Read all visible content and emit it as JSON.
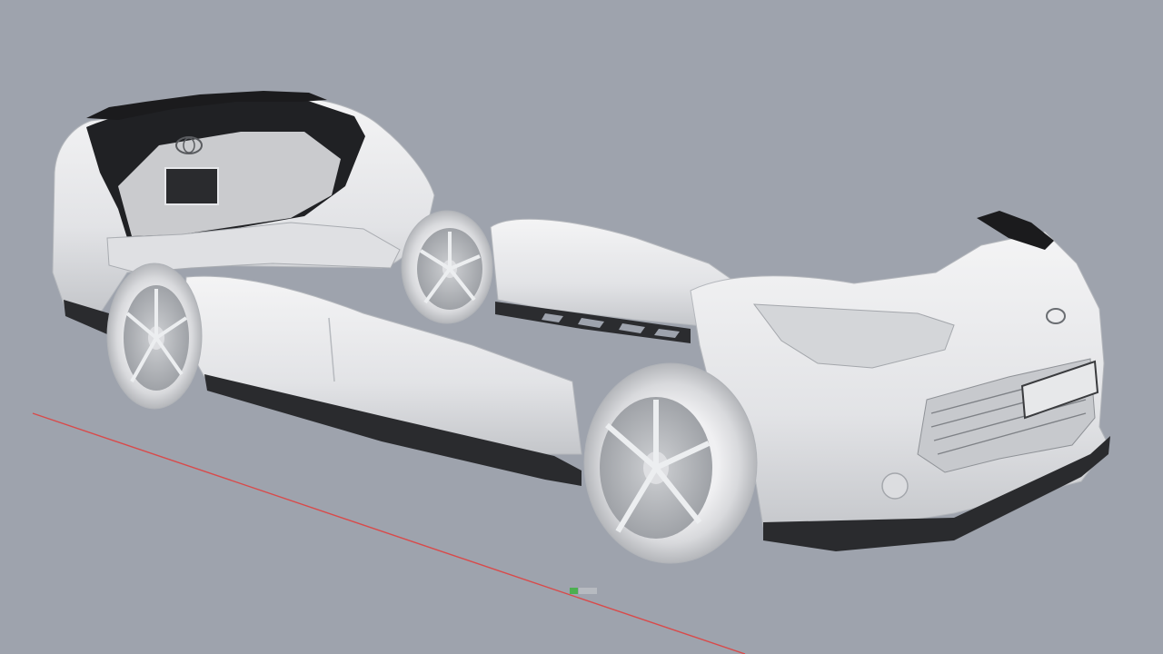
{
  "viewport": {
    "background_color": "#9ea3ad",
    "x_axis_color": "#d94a4a",
    "gizmo_green": "#4caf50",
    "gizmo_gray": "#b8bcc2",
    "mesh_fill": "#e9eaec",
    "mesh_shade": "#c9cbcf",
    "mesh_dark": "#1c1c1e",
    "view_name": "",
    "view_label": ""
  }
}
